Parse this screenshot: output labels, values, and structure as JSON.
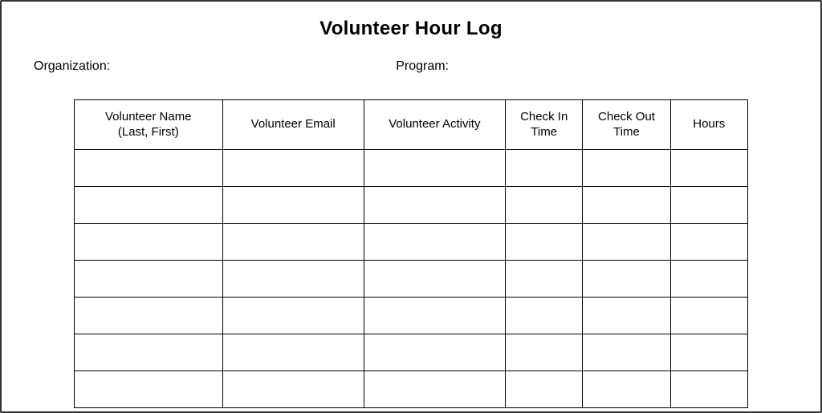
{
  "title": "Volunteer Hour Log",
  "meta": {
    "organization_label": "Organization:",
    "program_label": "Program:"
  },
  "table": {
    "headers": {
      "name_line1": "Volunteer Name",
      "name_line2": "(Last, First)",
      "email": "Volunteer Email",
      "activity": "Volunteer Activity",
      "checkin_line1": "Check In",
      "checkin_line2": "Time",
      "checkout_line1": "Check Out",
      "checkout_line2": "Time",
      "hours": "Hours"
    },
    "rows": [
      {
        "name": "",
        "email": "",
        "activity": "",
        "checkin": "",
        "checkout": "",
        "hours": ""
      },
      {
        "name": "",
        "email": "",
        "activity": "",
        "checkin": "",
        "checkout": "",
        "hours": ""
      },
      {
        "name": "",
        "email": "",
        "activity": "",
        "checkin": "",
        "checkout": "",
        "hours": ""
      },
      {
        "name": "",
        "email": "",
        "activity": "",
        "checkin": "",
        "checkout": "",
        "hours": ""
      },
      {
        "name": "",
        "email": "",
        "activity": "",
        "checkin": "",
        "checkout": "",
        "hours": ""
      },
      {
        "name": "",
        "email": "",
        "activity": "",
        "checkin": "",
        "checkout": "",
        "hours": ""
      },
      {
        "name": "",
        "email": "",
        "activity": "",
        "checkin": "",
        "checkout": "",
        "hours": ""
      }
    ]
  }
}
